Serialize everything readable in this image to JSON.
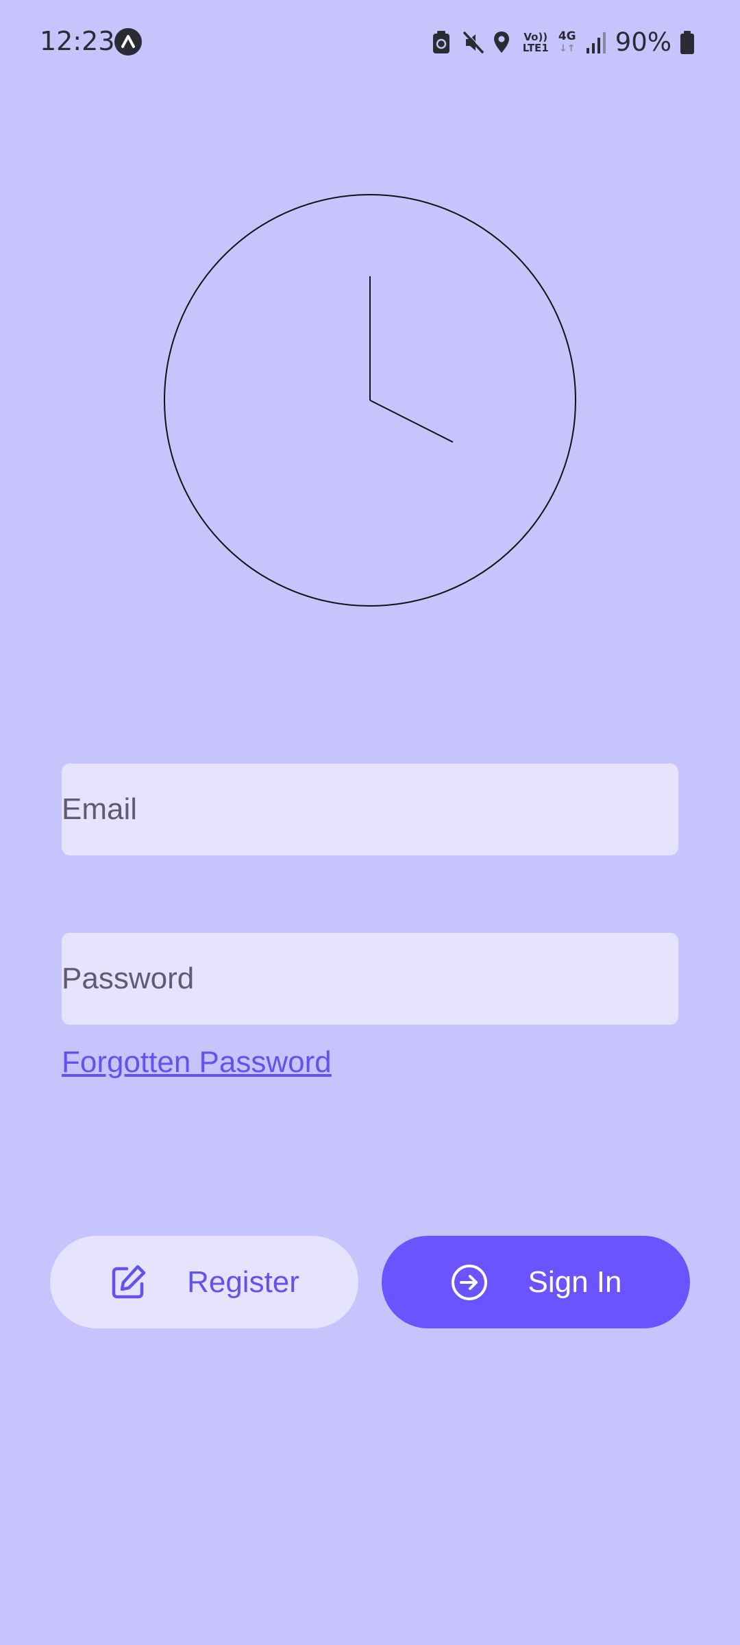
{
  "status_bar": {
    "time": "12:23",
    "app_icon": "launcher-icon",
    "volte_line1": "Vo))",
    "volte_line2": "LTE1",
    "network_type": "4G",
    "network_arrows": "↓↑",
    "battery_percent": "90%"
  },
  "clock": {
    "icon": "clock-icon"
  },
  "login_form": {
    "email_placeholder": "Email",
    "email_value": "",
    "password_placeholder": "Password",
    "password_value": "",
    "forgot_password_label": "Forgotten Password"
  },
  "actions": {
    "register_label": "Register",
    "register_icon": "edit-icon",
    "signin_label": "Sign In",
    "signin_icon": "arrow-right-circle-icon"
  },
  "colors": {
    "background": "#C6C3FD",
    "field_background": "#E6E3FE",
    "accent": "#6B53FF",
    "link": "#6650F0"
  }
}
